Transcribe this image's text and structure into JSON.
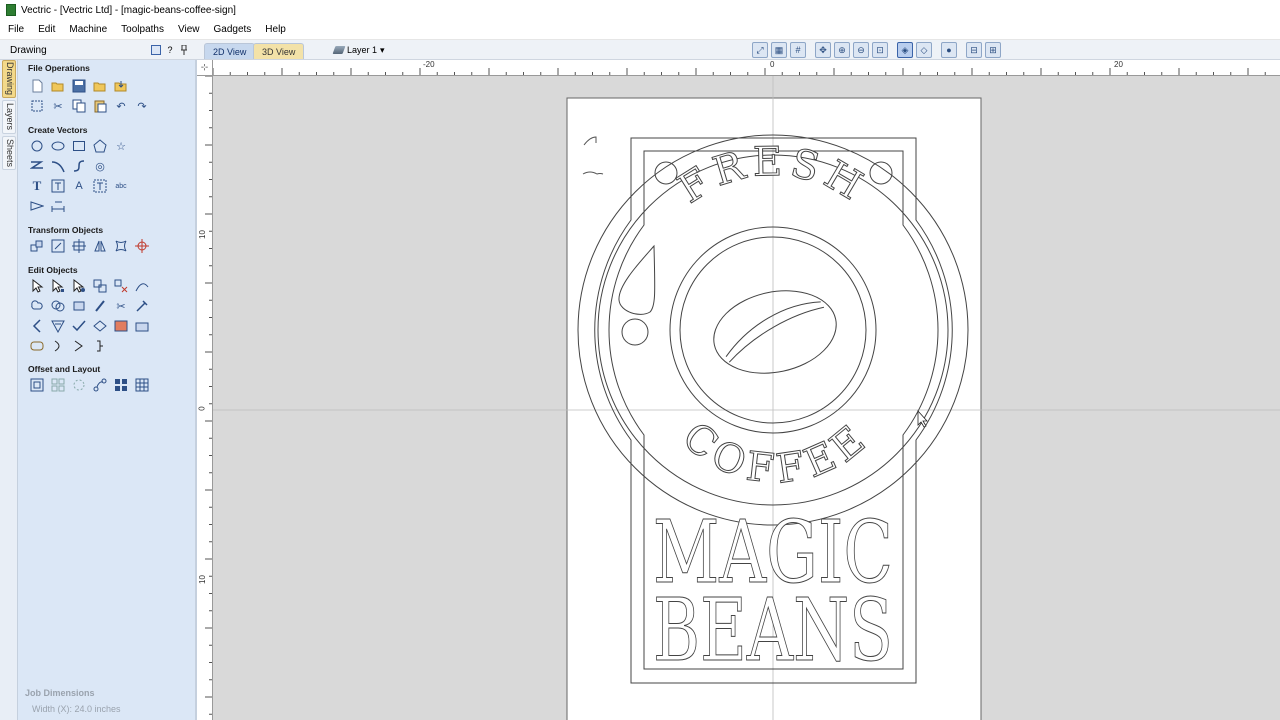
{
  "window": {
    "title": "Vectric - [Vectric Ltd] - [magic-beans-coffee-sign]"
  },
  "menu": {
    "items": [
      "File",
      "Edit",
      "Machine",
      "Toolpaths",
      "View",
      "Gadgets",
      "Help"
    ]
  },
  "panel": {
    "title": "Drawing",
    "pin_label": "?",
    "side_tabs": [
      "Drawing",
      "Layers",
      "Sheets"
    ],
    "sections": [
      {
        "title": "File Operations",
        "icons": [
          "new-file-icon",
          "open-file-icon",
          "save-icon",
          "open-folder-icon",
          "import-icon",
          "select-all-icon",
          "cut-icon",
          "copy-icon",
          "paste-icon",
          "undo-icon",
          "redo-icon"
        ]
      },
      {
        "title": "Create Vectors",
        "icons": [
          "circle-icon",
          "ellipse-icon",
          "rectangle-icon",
          "polygon-icon",
          "star-icon",
          "polyline-icon",
          "arc-icon",
          "curve-icon",
          "spiral-icon",
          "text-icon",
          "text-box-icon",
          "text-on-curve-icon",
          "auto-layout-text-icon",
          "dimension-icon",
          "measure-icon"
        ]
      },
      {
        "title": "Transform Objects",
        "icons": [
          "move-icon",
          "scale-icon",
          "align-icon",
          "mirror-icon",
          "distort-icon",
          "set-origin-icon"
        ]
      },
      {
        "title": "Edit Objects",
        "icons": [
          "select-icon",
          "node-edit-icon",
          "interactive-trim-icon",
          "group-icon",
          "ungroup-icon",
          "draw-curve-icon",
          "weld-icon",
          "merge-icon",
          "subtract-icon",
          "intersect-icon",
          "trim-icon",
          "join-icon",
          "fillet-icon",
          "chamfer-icon",
          "bend-icon",
          "close-vector-icon",
          "extend-icon",
          "smart-snap-icon",
          "unify-icon",
          "convert-icon",
          "inlay-icon",
          "offset-curve-icon",
          "break-icon",
          "split-icon"
        ]
      },
      {
        "title": "Offset and Layout",
        "icons": [
          "offset-icon",
          "array-copy-icon",
          "circular-array-icon",
          "copy-along-vector-icon",
          "nesting-icon",
          "tiling-icon"
        ]
      }
    ],
    "job_dimensions_label": "Job Dimensions",
    "job_width_text": "Width  (X): 24.0 inches"
  },
  "view_tabs": {
    "tab_2d": "2D View",
    "tab_3d": "3D View"
  },
  "layer": {
    "label": "Layer 1"
  },
  "view_tools": [
    "zoom-extents-icon",
    "grid-icon",
    "snap-grid-icon",
    "pan-icon",
    "zoom-in-icon",
    "zoom-out-icon",
    "zoom-box-icon",
    "toggle-view-icon",
    "selection-mode-icon",
    "render-icon",
    "split-view-icon",
    "layout-icon"
  ],
  "rulers": {
    "top": [
      "-20",
      "0",
      "20"
    ],
    "left": [
      "10",
      "0",
      "10"
    ]
  },
  "artwork": {
    "arc_text_top": "FRESH",
    "arc_text_bottom": "COFFEE",
    "line1": "MAGIC",
    "line2": "BEANS"
  }
}
